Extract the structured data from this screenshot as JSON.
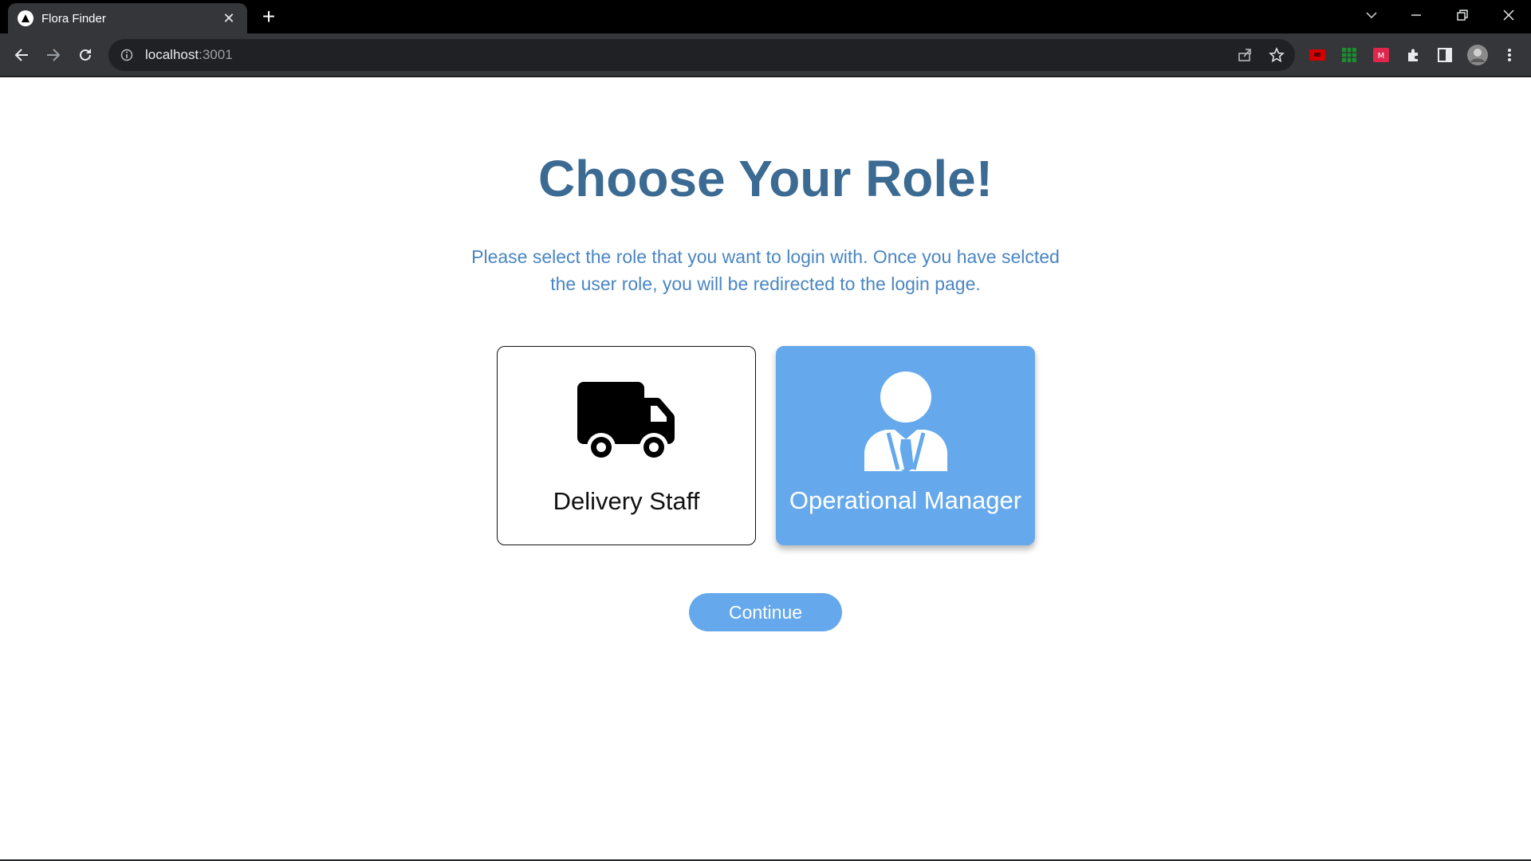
{
  "browser": {
    "tab_title": "Flora Finder",
    "new_tab_label": "+",
    "url_host": "localhost",
    "url_port": ":3001",
    "icons": [
      "back-icon",
      "forward-icon",
      "reload-icon",
      "site-info-icon",
      "share-icon",
      "bookmark-star-icon",
      "extensions-icon",
      "side-panel-icon",
      "profile-avatar",
      "chrome-menu-icon",
      "tab-search-icon",
      "minimize-icon",
      "restore-icon",
      "close-window-icon"
    ]
  },
  "page": {
    "title": "Choose Your Role!",
    "description": "Please select the role that you want to login with. Once you have selcted the user role, you will be redirected to the login page.",
    "roles": [
      {
        "label": "Delivery Staff",
        "icon": "truck-icon",
        "selected": false
      },
      {
        "label": "Operational Manager",
        "icon": "manager-icon",
        "selected": true
      }
    ],
    "continue_label": "Continue"
  },
  "colors": {
    "title": "#3b6a93",
    "description": "#4a86c2",
    "accent": "#65a9ec",
    "chrome_dark": "#35363a"
  }
}
